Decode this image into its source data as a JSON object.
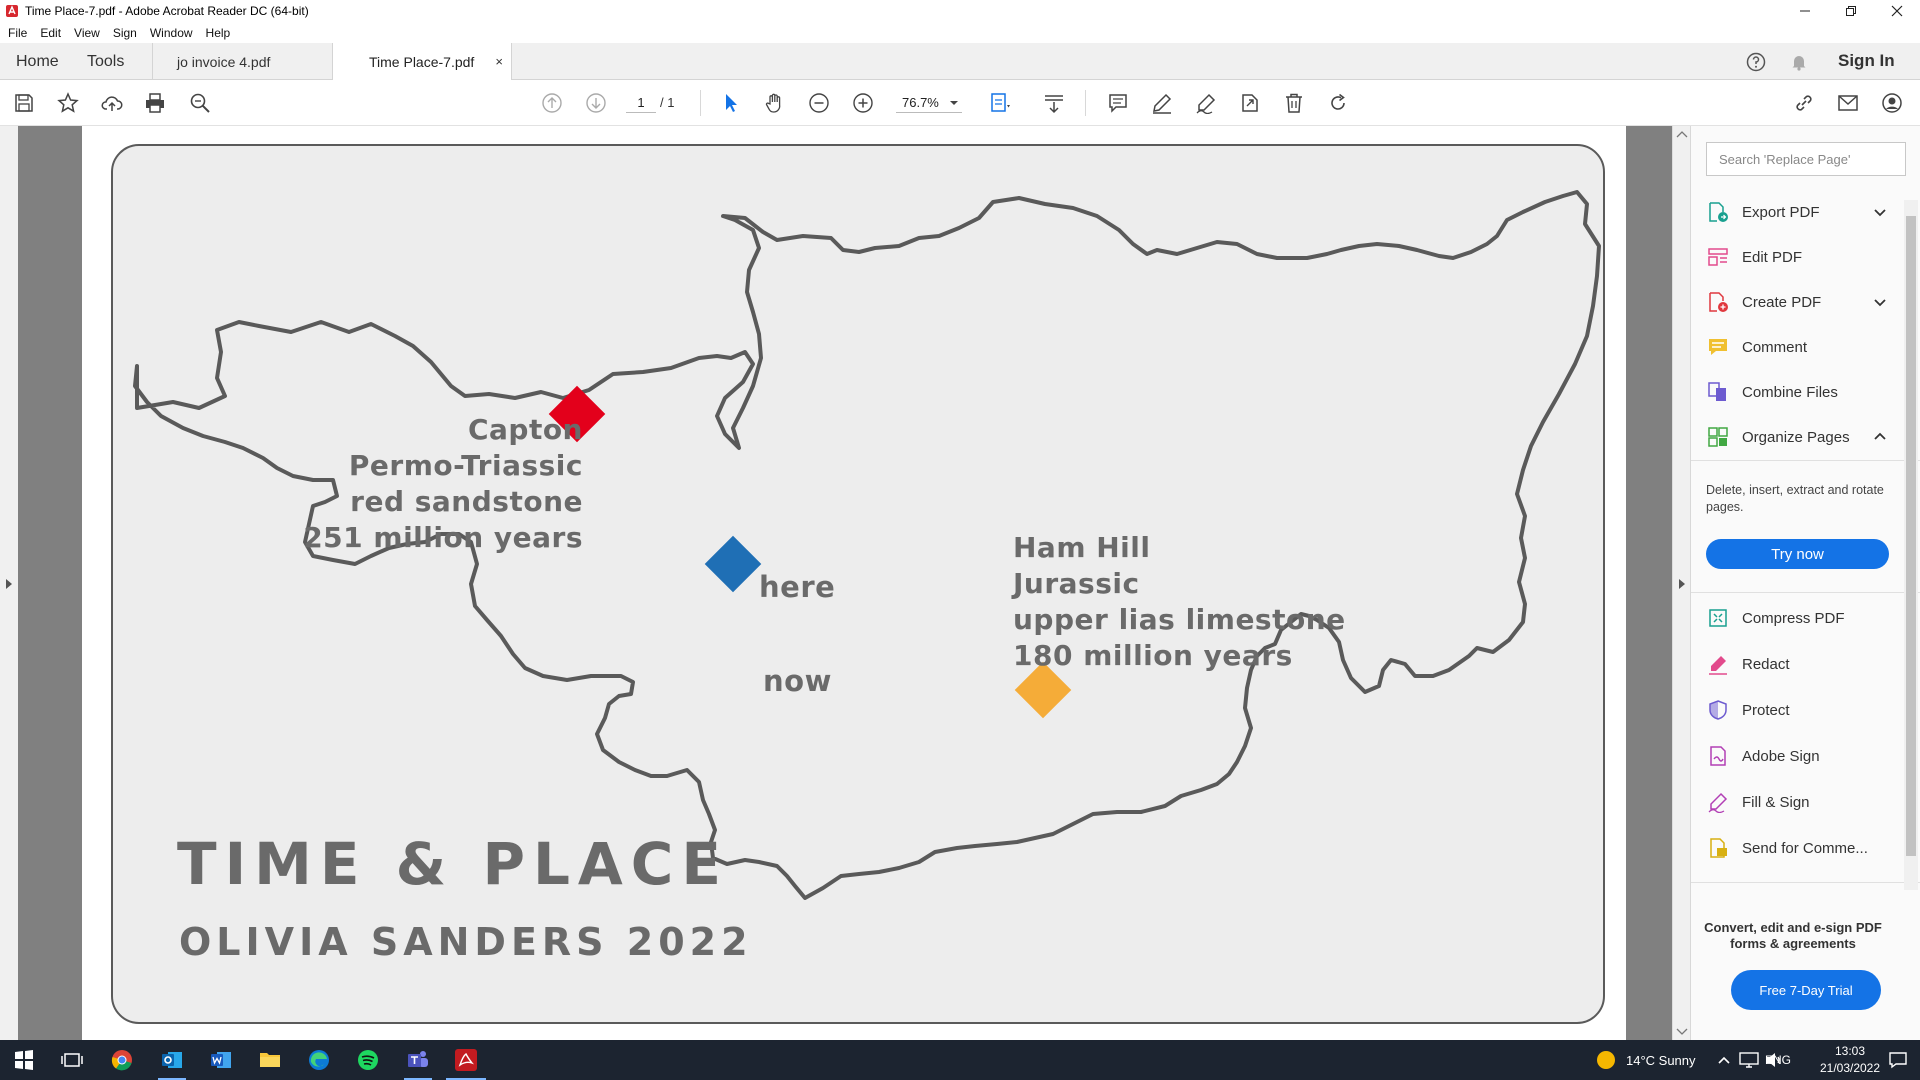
{
  "window": {
    "title": "Time  Place-7.pdf - Adobe Acrobat Reader DC (64-bit)"
  },
  "menu": [
    "File",
    "Edit",
    "View",
    "Sign",
    "Window",
    "Help"
  ],
  "tabs": {
    "home": "Home",
    "tools": "Tools",
    "doc1": "jo invoice 4.pdf",
    "doc2": "Time  Place-7.pdf",
    "close": "×",
    "sign_in": "Sign In"
  },
  "toolbar": {
    "page_current": "1",
    "page_total": "/ 1",
    "zoom": "76.7%"
  },
  "document": {
    "capton_lines": [
      "Capton",
      "Permo-Triassic",
      "red sandstone",
      "251 million years"
    ],
    "hamhill_lines": [
      "Ham Hill",
      "Jurassic",
      "upper lias limestone",
      "180 million years"
    ],
    "here": "here",
    "now": "now",
    "title": "TIME & PLACE",
    "subtitle": "OLIVIA SANDERS 2022",
    "colors": {
      "capton_marker": "#e3001b",
      "here_marker": "#1f6fb5",
      "hamhill_marker": "#f5ac38",
      "outline": "#5a5a5a"
    }
  },
  "right_panel": {
    "search_placeholder": "Search 'Replace Page'",
    "items": [
      {
        "label": "Export PDF"
      },
      {
        "label": "Edit PDF"
      },
      {
        "label": "Create PDF"
      },
      {
        "label": "Comment"
      },
      {
        "label": "Combine Files"
      },
      {
        "label": "Organize Pages"
      },
      {
        "label": "Compress PDF"
      },
      {
        "label": "Redact"
      },
      {
        "label": "Protect"
      },
      {
        "label": "Adobe Sign"
      },
      {
        "label": "Fill & Sign"
      },
      {
        "label": "Send for Comme..."
      }
    ],
    "organize_desc": "Delete, insert, extract and rotate pages.",
    "try_now": "Try now",
    "promo": "Convert, edit and e-sign PDF forms & agreements",
    "trial": "Free 7-Day Trial"
  },
  "taskbar": {
    "weather": "14°C  Sunny",
    "lang": "ENG",
    "time": "13:03",
    "date": "21/03/2022"
  }
}
